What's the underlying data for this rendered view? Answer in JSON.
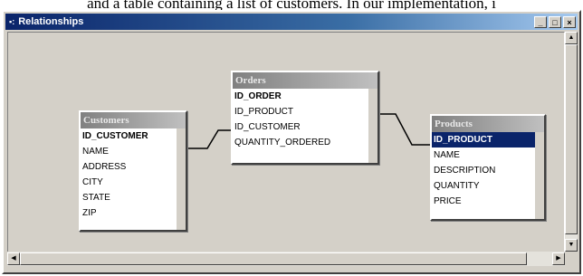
{
  "caption": "and a table containing a list of customers. In our implementation, i",
  "window": {
    "title": "Relationships",
    "controls": {
      "minimize": "_",
      "maximize": "□",
      "close": "×"
    }
  },
  "tables": {
    "customers": {
      "title": "Customers",
      "fields": [
        "ID_CUSTOMER",
        "NAME",
        "ADDRESS",
        "CITY",
        "STATE",
        "ZIP"
      ]
    },
    "orders": {
      "title": "Orders",
      "fields": [
        "ID_ORDER",
        "ID_PRODUCT",
        "ID_CUSTOMER",
        "QUANTITY_ORDERED"
      ]
    },
    "products": {
      "title": "Products",
      "fields": [
        "ID_PRODUCT",
        "NAME",
        "DESCRIPTION",
        "QUANTITY",
        "PRICE"
      ]
    }
  },
  "colors": {
    "window_bg": "#d4d0c8",
    "titlebar": "#0a246a",
    "selection": "#0a246a"
  }
}
